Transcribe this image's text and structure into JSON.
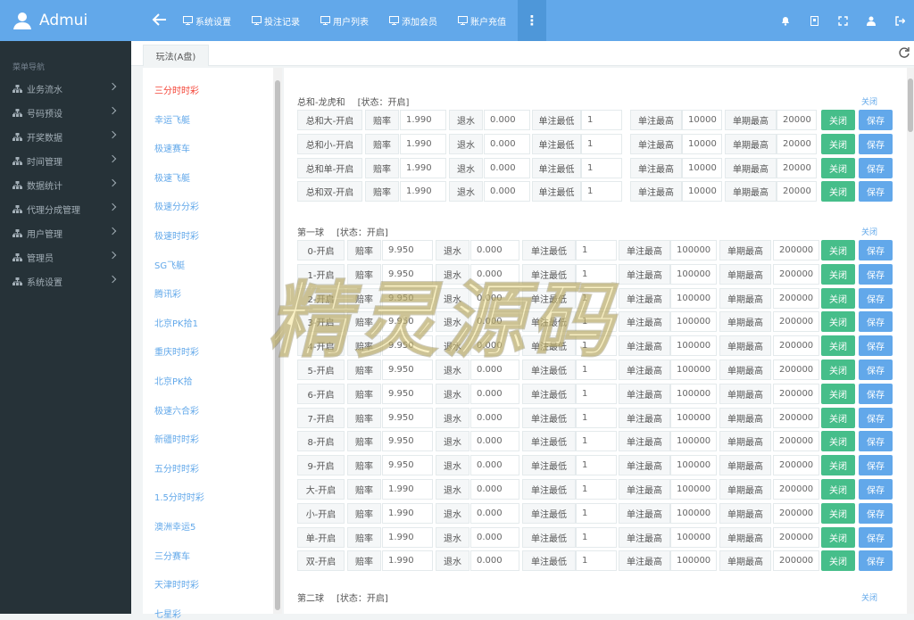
{
  "app": {
    "name": "Admui"
  },
  "topnav": [
    {
      "label": "系统设置",
      "icon": "monitor-icon"
    },
    {
      "label": "投注记录",
      "icon": "monitor-icon"
    },
    {
      "label": "用户列表",
      "icon": "monitor-icon"
    },
    {
      "label": "添加会员",
      "icon": "monitor-icon"
    },
    {
      "label": "账户充值",
      "icon": "monitor-icon"
    }
  ],
  "more_label": "⋮",
  "sidebar": {
    "header": "菜单导航",
    "items": [
      {
        "label": "业务流水"
      },
      {
        "label": "号码预设"
      },
      {
        "label": "开奖数据"
      },
      {
        "label": "时间管理"
      },
      {
        "label": "数据统计"
      },
      {
        "label": "代理分成管理"
      },
      {
        "label": "用户管理"
      },
      {
        "label": "管理员"
      },
      {
        "label": "系统设置"
      }
    ]
  },
  "tab": {
    "label": "玩法(A盘)"
  },
  "lotteries": [
    "三分时时彩",
    "幸运飞艇",
    "极速赛车",
    "极速飞艇",
    "极速分分彩",
    "极速时时彩",
    "SG飞艇",
    "腾讯彩",
    "北京PK拾1",
    "重庆时时彩",
    "北京PK拾",
    "极速六合彩",
    "新疆时时彩",
    "五分时时彩",
    "1.5分时时彩",
    "澳洲幸运5",
    "三分赛车",
    "天津时时彩",
    "七星彩"
  ],
  "active_lottery": 0,
  "labels": {
    "odds": "赔率",
    "rebate": "退水",
    "min_bet": "单注最低",
    "max_bet": "单注最高",
    "max_period": "单期最高",
    "close": "关闭",
    "save": "保存",
    "section_close": "关闭"
  },
  "sections": [
    {
      "title": "总和-龙虎和",
      "status": "[状态：开启]",
      "rows": [
        {
          "name": "总和大-开启",
          "odds": "1.990",
          "rebate": "0.000",
          "min": "1",
          "max": "10000",
          "period": "20000"
        },
        {
          "name": "总和小-开启",
          "odds": "1.990",
          "rebate": "0.000",
          "min": "1",
          "max": "10000",
          "period": "20000"
        },
        {
          "name": "总和单-开启",
          "odds": "1.990",
          "rebate": "0.000",
          "min": "1",
          "max": "10000",
          "period": "20000"
        },
        {
          "name": "总和双-开启",
          "odds": "1.990",
          "rebate": "0.000",
          "min": "1",
          "max": "10000",
          "period": "20000"
        }
      ]
    },
    {
      "title": "第一球",
      "status": "[状态：开启]",
      "rows": [
        {
          "name": "0-开启",
          "odds": "9.950",
          "rebate": "0.000",
          "min": "1",
          "max": "100000",
          "period": "200000"
        },
        {
          "name": "1-开启",
          "odds": "9.950",
          "rebate": "0.000",
          "min": "1",
          "max": "100000",
          "period": "200000"
        },
        {
          "name": "2-开启",
          "odds": "9.950",
          "rebate": "0.000",
          "min": "1",
          "max": "100000",
          "period": "200000"
        },
        {
          "name": "3-开启",
          "odds": "9.950",
          "rebate": "0.000",
          "min": "1",
          "max": "100000",
          "period": "200000"
        },
        {
          "name": "4-开启",
          "odds": "9.950",
          "rebate": "0.000",
          "min": "1",
          "max": "100000",
          "period": "200000"
        },
        {
          "name": "5-开启",
          "odds": "9.950",
          "rebate": "0.000",
          "min": "1",
          "max": "100000",
          "period": "200000"
        },
        {
          "name": "6-开启",
          "odds": "9.950",
          "rebate": "0.000",
          "min": "1",
          "max": "100000",
          "period": "200000"
        },
        {
          "name": "7-开启",
          "odds": "9.950",
          "rebate": "0.000",
          "min": "1",
          "max": "100000",
          "period": "200000"
        },
        {
          "name": "8-开启",
          "odds": "9.950",
          "rebate": "0.000",
          "min": "1",
          "max": "100000",
          "period": "200000"
        },
        {
          "name": "9-开启",
          "odds": "9.950",
          "rebate": "0.000",
          "min": "1",
          "max": "100000",
          "period": "200000"
        },
        {
          "name": "大-开启",
          "odds": "1.990",
          "rebate": "0.000",
          "min": "1",
          "max": "100000",
          "period": "200000"
        },
        {
          "name": "小-开启",
          "odds": "1.990",
          "rebate": "0.000",
          "min": "1",
          "max": "100000",
          "period": "200000"
        },
        {
          "name": "单-开启",
          "odds": "1.990",
          "rebate": "0.000",
          "min": "1",
          "max": "100000",
          "period": "200000"
        },
        {
          "name": "双-开启",
          "odds": "1.990",
          "rebate": "0.000",
          "min": "1",
          "max": "100000",
          "period": "200000"
        }
      ]
    },
    {
      "title": "第二球",
      "status": "[状态：开启]",
      "rows": []
    }
  ],
  "watermark": "精灵源码",
  "colors": {
    "topbar": "#62a8ea",
    "sidebar": "#263238",
    "green": "#46be8a",
    "blue": "#62a8ea",
    "active": "#f44336"
  }
}
